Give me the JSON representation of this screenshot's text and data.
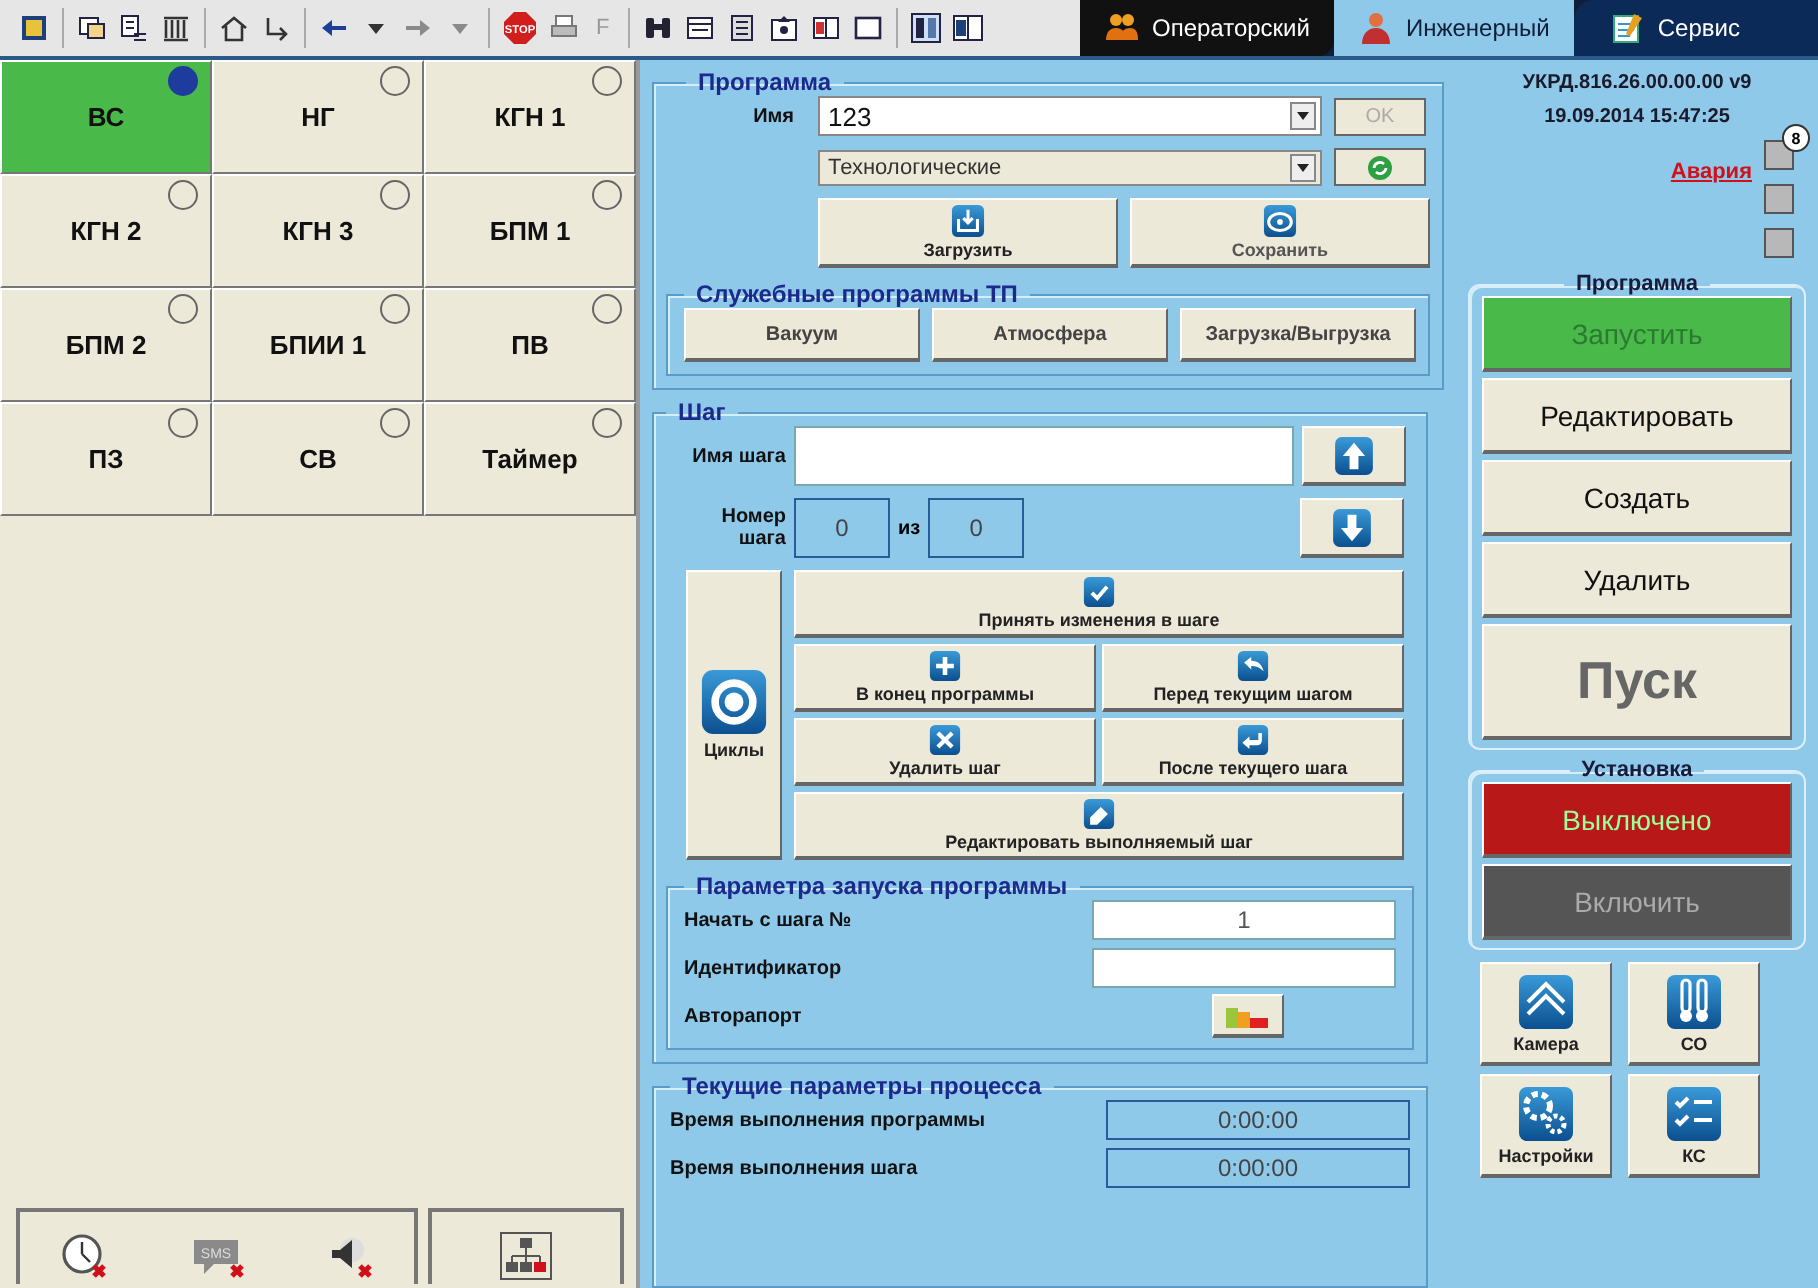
{
  "toolbar": {
    "stop_label": "STOP",
    "key_label": "F"
  },
  "tabs": [
    {
      "label": "Операторский",
      "selected": false,
      "kind": "operators"
    },
    {
      "label": "Инженерный",
      "selected": true,
      "kind": "engineer"
    },
    {
      "label": "Сервис",
      "selected": false,
      "kind": "service"
    }
  ],
  "units": [
    {
      "label": "ВС",
      "selected": true,
      "active": true
    },
    {
      "label": "НГ",
      "selected": false,
      "active": false
    },
    {
      "label": "КГН 1",
      "selected": false,
      "active": false
    },
    {
      "label": "КГН 2",
      "selected": false,
      "active": false
    },
    {
      "label": "КГН 3",
      "selected": false,
      "active": false
    },
    {
      "label": "БПМ 1",
      "selected": false,
      "active": false
    },
    {
      "label": "БПМ 2",
      "selected": false,
      "active": false
    },
    {
      "label": "БПИИ 1",
      "selected": false,
      "active": false
    },
    {
      "label": "ПВ",
      "selected": false,
      "active": false
    },
    {
      "label": "ПЗ",
      "selected": false,
      "active": false
    },
    {
      "label": "СВ",
      "selected": false,
      "active": false
    },
    {
      "label": "Таймер",
      "selected": false,
      "active": false
    }
  ],
  "status_icons": [
    {
      "kind": "clock"
    },
    {
      "kind": "sms",
      "label": "SMS"
    },
    {
      "kind": "speaker"
    },
    {
      "kind": "network"
    }
  ],
  "program": {
    "title": "Программа",
    "name_label": "Имя",
    "name_value": "123",
    "ok": "OK",
    "ok_disabled": true,
    "category": "Технологические",
    "load": "Загрузить",
    "save": "Сохранить",
    "service": {
      "title": "Служебные программы ТП",
      "buttons": [
        "Вакуум",
        "Атмосфера",
        "Загрузка/Выгрузка"
      ]
    }
  },
  "step": {
    "title": "Шаг",
    "name_label": "Имя шага",
    "number_label": "Номер шага",
    "number": "0",
    "of": "из",
    "total": "0",
    "cycles": "Циклы",
    "actions": [
      {
        "label": "Принять изменения в  шаге",
        "kind": "accept"
      },
      {
        "label": "В конец программы",
        "kind": "append"
      },
      {
        "label": "Перед текущим шагом",
        "kind": "insert-before"
      },
      {
        "label": "Удалить шаг",
        "kind": "delete"
      },
      {
        "label": "После текущего шага",
        "kind": "insert-after"
      },
      {
        "label": "Редактировать выполняемый шаг",
        "kind": "edit"
      }
    ]
  },
  "launch": {
    "title": "Параметра запуска программы",
    "rows": [
      {
        "label": "Начать с шага №",
        "kind": "field",
        "value": "1"
      },
      {
        "label": "Идентификатор",
        "kind": "field"
      },
      {
        "label": "Авторапорт",
        "kind": "report"
      }
    ]
  },
  "process": {
    "title": "Текущие параметры процесса",
    "rows": [
      {
        "label": "Время выполнения программы",
        "value": "0:00:00"
      },
      {
        "label": "Время выполнения шага",
        "value": "0:00:00"
      }
    ]
  },
  "header": {
    "version": "УКРД.816.26.00.00.00 v9",
    "datetime": "19.09.2014 15:47:25",
    "alarm": "Авария",
    "alarm_count": "8"
  },
  "program_controls": {
    "title": "Программа",
    "buttons": [
      {
        "label": "Запустить",
        "kind": "green"
      },
      {
        "label": "Редактировать",
        "kind": "plain"
      },
      {
        "label": "Создать",
        "kind": "plain"
      },
      {
        "label": "Удалить",
        "kind": "plain"
      },
      {
        "label": "Пуск",
        "kind": "big"
      }
    ]
  },
  "installation": {
    "title": "Установка",
    "buttons": [
      {
        "label": "Выключено",
        "kind": "red"
      },
      {
        "label": "Включить",
        "kind": "dark"
      }
    ]
  },
  "shortcuts": [
    {
      "label": "Камера",
      "kind": "camera"
    },
    {
      "label": "СО",
      "kind": "thermometer"
    },
    {
      "label": "Настройки",
      "kind": "gears"
    },
    {
      "label": "КС",
      "kind": "checklist"
    }
  ]
}
